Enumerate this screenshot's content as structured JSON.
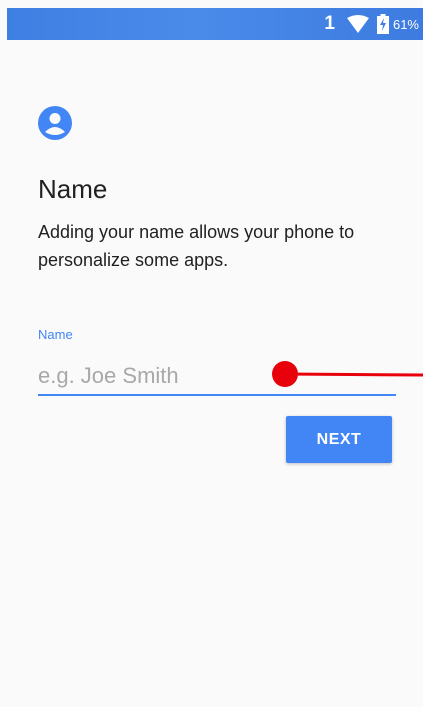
{
  "status_bar": {
    "sim_indicator": "1",
    "wifi_icon": "wifi-icon",
    "battery_icon": "battery-charging-icon",
    "battery_percent": "61%",
    "color": "#4285f4"
  },
  "setup": {
    "icon": "account-circle-icon",
    "title": "Name",
    "description": "Adding your name allows your phone to personalize some apps.",
    "field_label": "Name",
    "input_value": "",
    "input_placeholder": "e.g. Joe Smith",
    "next_label": "NEXT"
  },
  "colors": {
    "accent": "#4285f4",
    "annotation": "#e8000b"
  }
}
